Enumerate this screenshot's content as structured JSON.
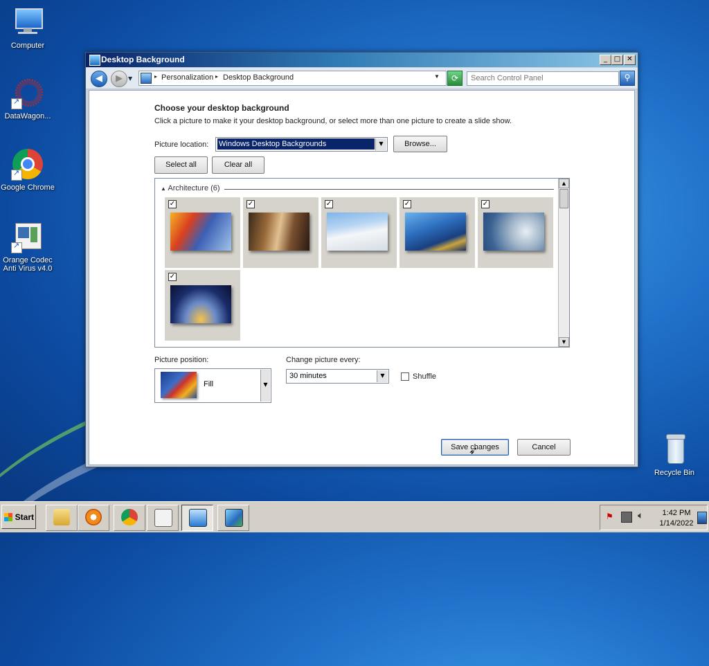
{
  "desktop": {
    "icons": [
      {
        "label": "Computer"
      },
      {
        "label": "DataWagon..."
      },
      {
        "label": "Google Chrome"
      },
      {
        "label": "Orange Codec Anti Virus v4.0"
      },
      {
        "label": "Recycle Bin"
      }
    ]
  },
  "window": {
    "title": "Desktop Background",
    "breadcrumb": [
      "Personalization",
      "Desktop Background"
    ],
    "search_placeholder": "Search Control Panel"
  },
  "main": {
    "heading": "Choose your desktop background",
    "description": "Click a picture to make it your desktop background, or select more than one picture to create a slide show.",
    "picture_location_label": "Picture location:",
    "picture_location_value": "Windows Desktop Backgrounds",
    "browse_label": "Browse...",
    "select_all_label": "Select all",
    "clear_all_label": "Clear all",
    "group_header": "Architecture (6)",
    "thumbnails": [
      {
        "checked": true,
        "name": "architecture-1"
      },
      {
        "checked": true,
        "name": "architecture-2"
      },
      {
        "checked": true,
        "name": "architecture-3"
      },
      {
        "checked": true,
        "name": "architecture-4"
      },
      {
        "checked": true,
        "name": "architecture-5"
      },
      {
        "checked": true,
        "name": "architecture-6"
      }
    ],
    "picture_position_label": "Picture position:",
    "picture_position_value": "Fill",
    "change_every_label": "Change picture every:",
    "change_every_value": "30 minutes",
    "shuffle_label": "Shuffle",
    "shuffle_checked": false,
    "save_label": "Save changes",
    "cancel_label": "Cancel"
  },
  "taskbar": {
    "start_label": "Start",
    "time": "1:42 PM",
    "date": "1/14/2022"
  }
}
